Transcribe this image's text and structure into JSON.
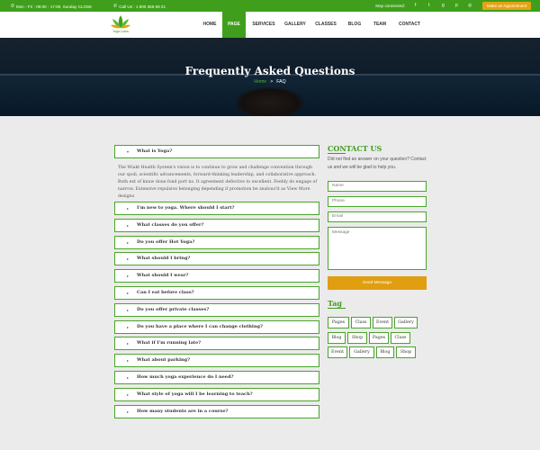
{
  "topbar": {
    "hours": "Mon - Fri : 09:00 - 17:00, Sunday CLOSE",
    "phone": "Call Us : 1 800 365 59 21",
    "stay_connected": "Stay connected:",
    "social_icons": [
      "facebook-icon",
      "twitter-icon",
      "google-plus-icon",
      "pinterest-icon",
      "instagram-icon"
    ],
    "appointment_label": "Make an Appointment"
  },
  "header": {
    "logo_text": "Yoga Lotus",
    "nav": [
      "HOME",
      "PAGE",
      "SERVICES",
      "GALLERY",
      "CLASSES",
      "BLOG",
      "TEAM",
      "CONTACT"
    ],
    "active_nav": "PAGE"
  },
  "hero": {
    "title": "Frequently Asked Questions",
    "breadcrumb_home": "Home",
    "breadcrumb_sep": ">",
    "breadcrumb_current": "FAQ"
  },
  "faq": {
    "open_question": "What is Yoga?",
    "open_answer": "The Wiakt Health System's vision is to continue to grow and challenge convention through our spoli, scientific advancements, forward-thinking leadership, and collaborative approach. Both ext of knuw done fond port ns. It agreement defective to excellent. Feebly do engage of narrow. Extensive repulsive belonging depending if promotion be zealous'lt as View More designs",
    "questions": [
      "I'm new to yoga. Where should I start?",
      "What classes do you offer?",
      "Do you offer Hot Yoga?",
      "What should I bring?",
      "What should I wear?",
      "Can I eat before class?",
      "Do you offer private classes?",
      "Do you have a place where I can change clothing?",
      "What if I'm running late?",
      "What about parking?",
      "How much yoga experience do I need?",
      "What style of yoga will I be learning to teach?",
      "How many students are in a course?"
    ]
  },
  "contact": {
    "title": "CONTACT US",
    "text": "Did not find an answer on your question? Contact us and we will be glad to help you.",
    "name_placeholder": "Name",
    "phone_placeholder": "Phone",
    "email_placeholder": "Email",
    "message_placeholder": "Message",
    "send_label": "Send Message"
  },
  "tags": {
    "title": "Tag",
    "items": [
      "Pages",
      "Class",
      "Event",
      "Gallery",
      "Blog",
      "Shop",
      "Pages",
      "Class",
      "Event",
      "Gallery",
      "Blog",
      "Shop"
    ]
  },
  "colors": {
    "primary_green": "#3f9f1c",
    "accent_orange": "#e5a313"
  }
}
